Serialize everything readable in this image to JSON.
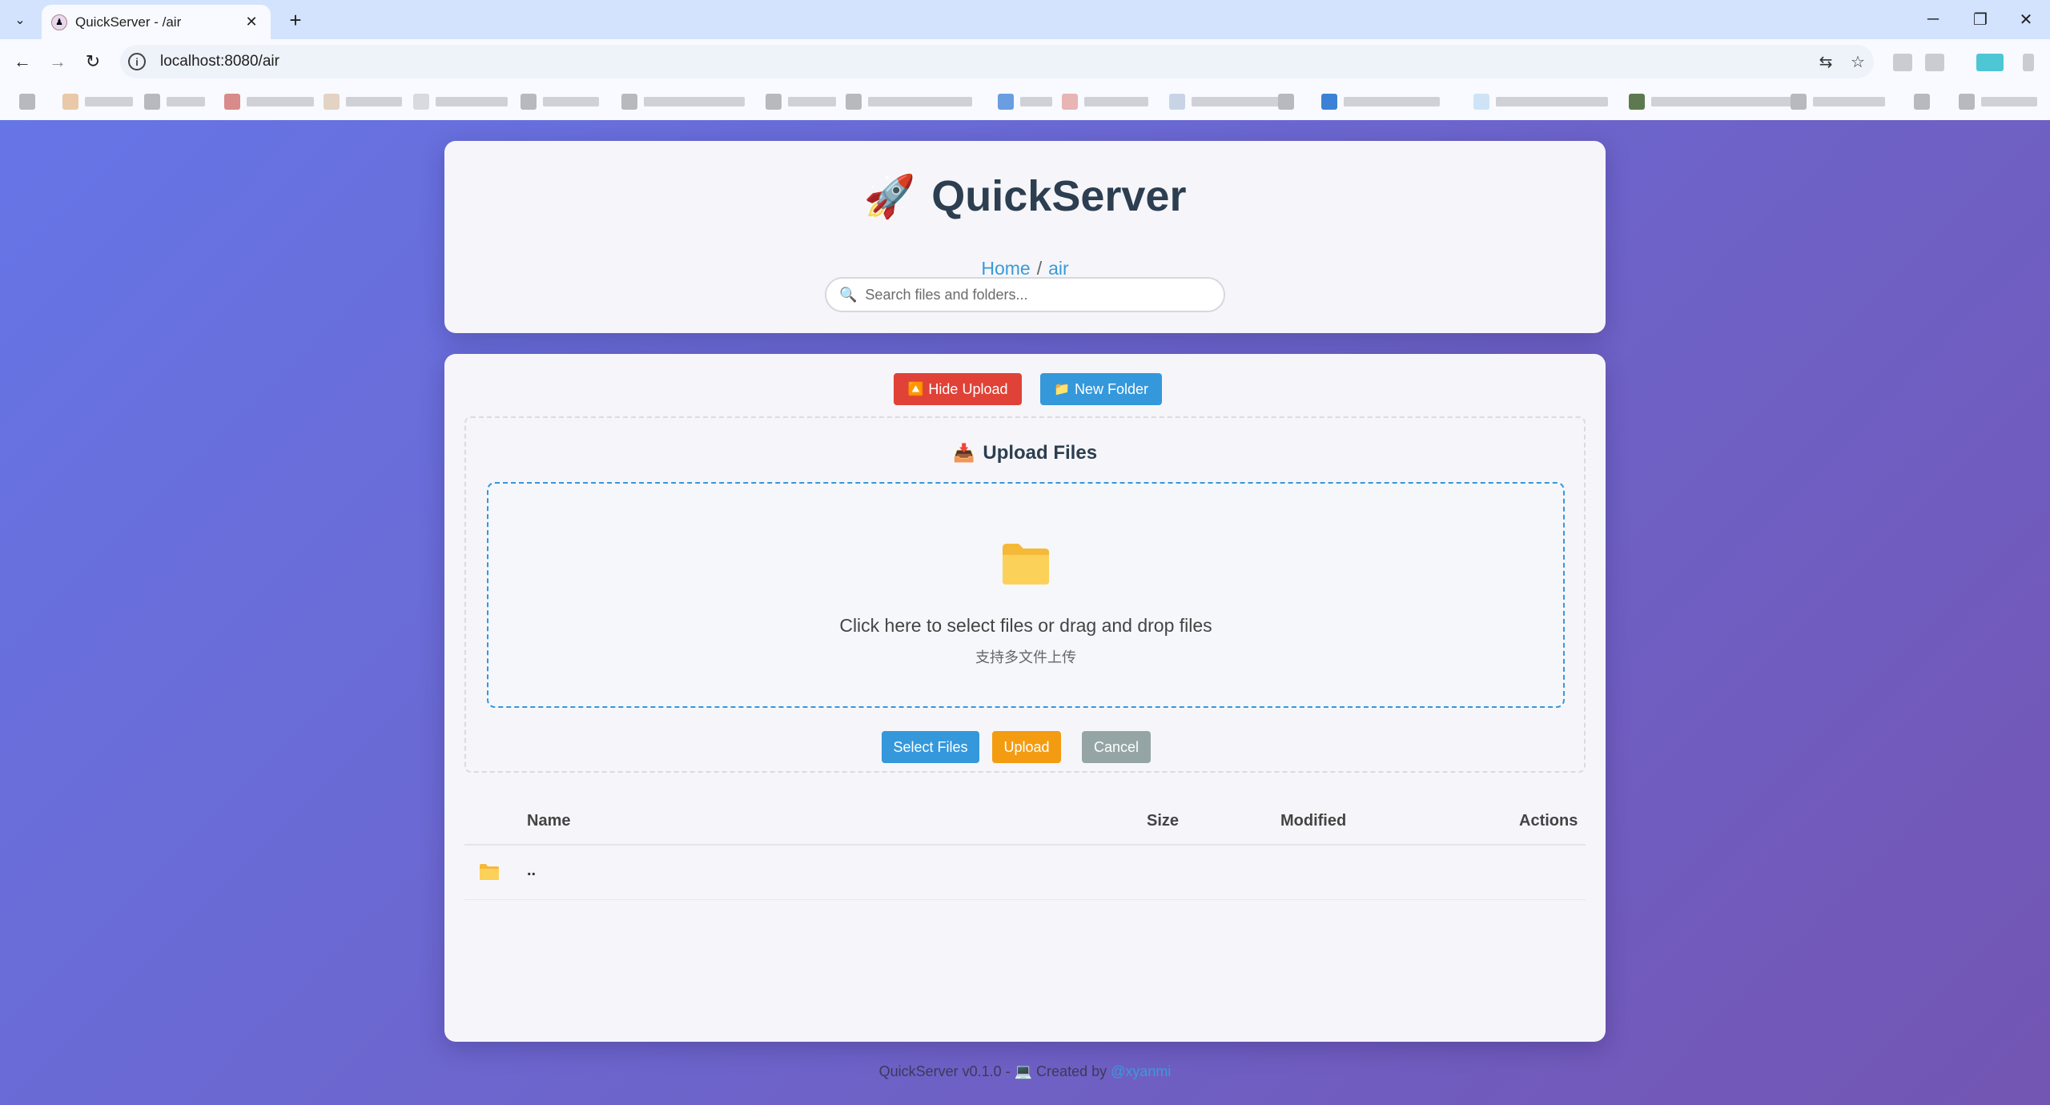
{
  "browser": {
    "tab_title": "QuickServer - /air",
    "url": "localhost:8080/air"
  },
  "app": {
    "title": "QuickServer",
    "logo_emoji": "🚀",
    "breadcrumb": {
      "home": "Home",
      "separator": "/",
      "current": "air"
    },
    "search_placeholder": "Search files and folders..."
  },
  "actions": {
    "hide_upload": "Hide Upload",
    "new_folder": "New Folder"
  },
  "upload": {
    "title": "Upload Files",
    "drop_text": "Click here to select files or drag and drop files",
    "drop_subtext": "支持多文件上传",
    "select_files": "Select Files",
    "upload": "Upload",
    "cancel": "Cancel"
  },
  "table": {
    "columns": [
      "Name",
      "Size",
      "Modified",
      "Actions"
    ],
    "rows": [
      {
        "name": "..",
        "size": "",
        "modified": "",
        "icon": "folder-icon"
      }
    ]
  },
  "footer": {
    "text": "QuickServer v0.1.0 - 💻 Created by",
    "link": "@xyanmi"
  },
  "colors": {
    "gradient_start": "#6675e6",
    "gradient_end": "#7355b3",
    "danger": "#e04237",
    "primary": "#3498db",
    "warning": "#f39c12",
    "muted": "#95a5a6"
  }
}
